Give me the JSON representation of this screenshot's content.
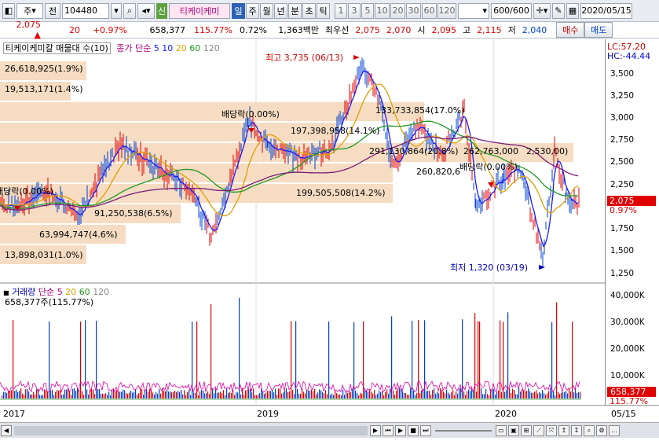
{
  "toolbar": {
    "market": "주",
    "prev_label": "전",
    "code": "104480",
    "credit_badge": "신",
    "stock_name": "티케이케미",
    "periods": [
      "일",
      "주",
      "월",
      "년",
      "분",
      "초",
      "틱"
    ],
    "active_period": "일",
    "intervals": [
      "1",
      "3",
      "5",
      "10",
      "20",
      "30",
      "60",
      "120"
    ],
    "count": "600/600",
    "date": "2020/05/15"
  },
  "quote": {
    "price": "2,075",
    "arrow": "▲",
    "change": "20",
    "change_pct": "+0.97%",
    "volume": "658,377",
    "volume_ratio": "115.77%",
    "turnover": "0.72%",
    "amount": "1,363백만",
    "best_label": "최우선",
    "ask": "2,075",
    "bid": "2,070",
    "open_label": "시",
    "open": "2,095",
    "high_label": "고",
    "high": "2,115",
    "low_label": "저",
    "low": "2,040",
    "buy_label": "매수",
    "sell_label": "매도"
  },
  "price_panel": {
    "title": "티케이케미칼 매물대 수(10)",
    "ma_label": "종가 단순",
    "ma_periods": [
      "5",
      "10",
      "20",
      "60",
      "120"
    ],
    "ma_colors": [
      "#1a1aff",
      "#e0a000",
      "#229922",
      "#7a1a7a"
    ],
    "lc": "LC:57.20",
    "hc": "HC:-44.44",
    "current_price": "2,075",
    "current_pct": "0.97%",
    "high_note": "최고 3,735 (06/13)",
    "low_note": "최저 1,320 (03/19)",
    "dividend_labels": [
      "배당락(0.00%)",
      "배당락(0.00%)",
      "배당락(0.00%)"
    ],
    "volume_profile": [
      "26,618,925(1.9%)",
      "19,513,171(1.4%)",
      "133,733,854(17.0%)",
      "197,398,958(14.1%)",
      "291,130,864(20.8%)",
      "262,763,000",
      "260,820,6",
      "199,505,508(14.2%)",
      "91,250,538(6.5%)",
      "63,994,747(4.6%)",
      "13,898,031(1.0%)"
    ],
    "price_tag_2530": "2,530,00)"
  },
  "volume_panel": {
    "title": "거래량",
    "ma_label": "단순",
    "ma_periods": [
      "5",
      "20",
      "60",
      "120"
    ],
    "current": "658,377주(115.77%)",
    "current_tag": "658,377",
    "current_pct": "115.77%"
  },
  "axes": {
    "price_ticks": [
      "3,500",
      "3,250",
      "3,000",
      "2,750",
      "2,500",
      "2,250",
      "1,750",
      "1,500",
      "1,250"
    ],
    "volume_ticks": [
      "40,000K",
      "30,000K",
      "20,000K",
      "10,000K"
    ],
    "x_labels": [
      "2017",
      "2019",
      "2020"
    ],
    "last_date": "05/15"
  }
}
